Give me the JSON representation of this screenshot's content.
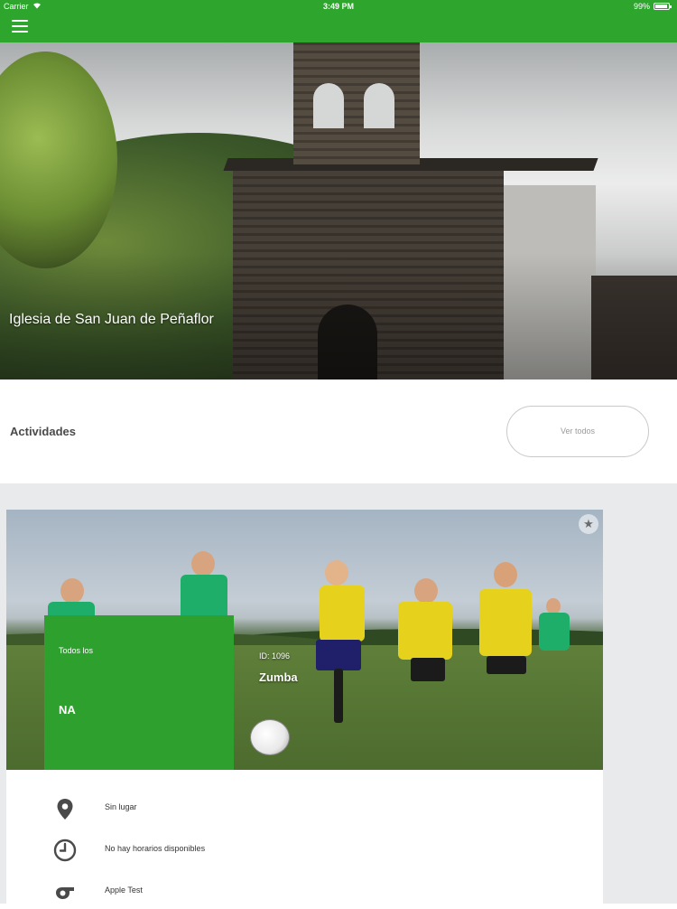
{
  "status_bar": {
    "carrier": "Carrier",
    "time": "3:49 PM",
    "battery": "99%"
  },
  "nav": {
    "menu_icon": "hamburger-menu-icon",
    "color": "#2ea62e"
  },
  "hero": {
    "title": "Iglesia de San Juan de Peñaflor"
  },
  "activities": {
    "section_label": "Actividades",
    "see_all_label": "Ver todos"
  },
  "card": {
    "favorite_icon": "star-icon",
    "badge_subtitle": "Todos los",
    "badge_title": "NA",
    "badge_color": "#2ea02e",
    "id_label": "ID: 1096",
    "name": "Zumba",
    "details": [
      {
        "icon": "location-pin-icon",
        "text": "Sin lugar"
      },
      {
        "icon": "clock-icon",
        "text": "No hay horarios disponibles"
      },
      {
        "icon": "whistle-icon",
        "text": "Apple Test"
      }
    ]
  }
}
